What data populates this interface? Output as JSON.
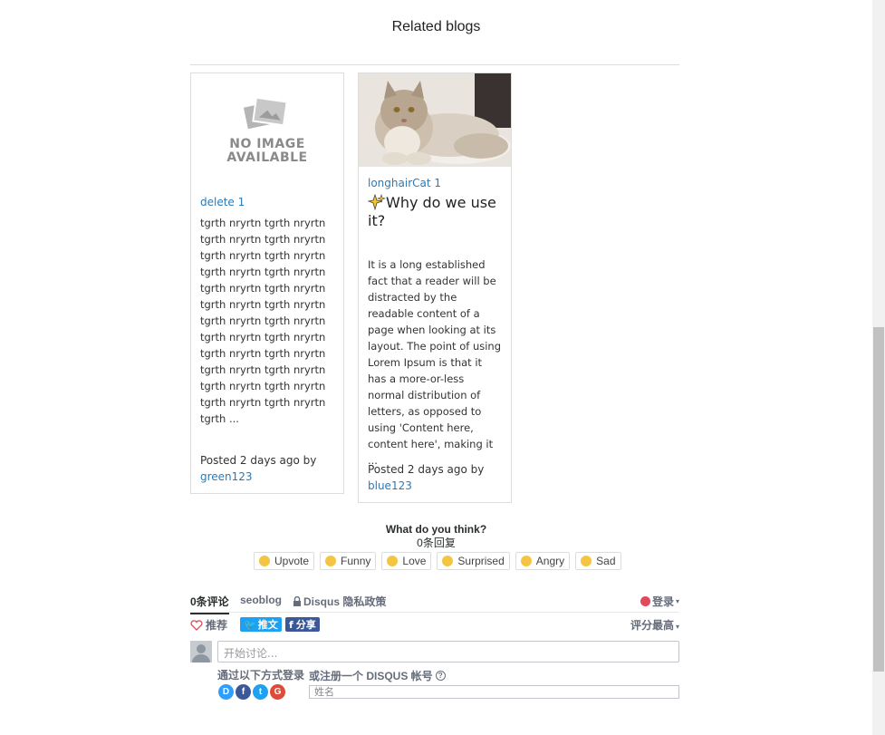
{
  "section": {
    "title": "Related blogs"
  },
  "cards": [
    {
      "image": "NO IMAGE\nAVAILABLE",
      "author": "delete 1",
      "excerpt": "tgrth nryrtn tgrth nryrtn tgrth nryrtn tgrth nryrtn tgrth nryrtn tgrth nryrtn tgrth nryrtn tgrth nryrtn tgrth nryrtn tgrth nryrtn tgrth nryrtn tgrth nryrtn tgrth nryrtn tgrth nryrtn tgrth nryrtn tgrth nryrtn tgrth nryrtn tgrth nryrtn tgrth nryrtn tgrth nryrtn tgrth nryrtn tgrth nryrtn tgrth nryrtn tgrth nryrtn tgrth ...",
      "posted": "Posted 2 days ago by",
      "user": "green123"
    },
    {
      "author": "longhairCat 1",
      "title": "Why do we use it?",
      "excerpt": "It is a long established fact that a reader will be distracted by the readable content of a page when looking at its layout. The point of using Lorem Ipsum is that it has a more-or-less normal distribution of letters, as opposed to using 'Content here, content here', making it ...",
      "posted": "Posted 2 days ago by",
      "user": "blue123"
    }
  ],
  "disqus": {
    "prompt": "What do you think?",
    "reply_count": "0条回复",
    "reactions": [
      {
        "label": "Upvote",
        "icon": "thumbs-up-icon"
      },
      {
        "label": "Funny",
        "icon": "laughing-face-icon"
      },
      {
        "label": "Love",
        "icon": "heart-eyes-icon"
      },
      {
        "label": "Surprised",
        "icon": "surprised-face-icon"
      },
      {
        "label": "Angry",
        "icon": "angry-face-icon"
      },
      {
        "label": "Sad",
        "icon": "sad-face-icon"
      }
    ],
    "tabs": {
      "comments": "0条评论",
      "site": "seoblog",
      "privacy": "Disqus 隐私政策"
    },
    "login": "登录",
    "recommend": "推荐",
    "tweet": "推文",
    "share": "分享",
    "sort": "评分最高",
    "comment_placeholder": "开始讨论...",
    "login_with": "通过以下方式登录",
    "or_register": "或注册一个 DISQUS 帐号",
    "name_placeholder": "姓名",
    "social": [
      "D",
      "f",
      "t",
      "G"
    ]
  },
  "colors": {
    "link": "#2a7ab8",
    "tweet": "#1da1f2",
    "facebook": "#3b5998",
    "google": "#dd4b39",
    "disqus": "#2e9fff"
  }
}
